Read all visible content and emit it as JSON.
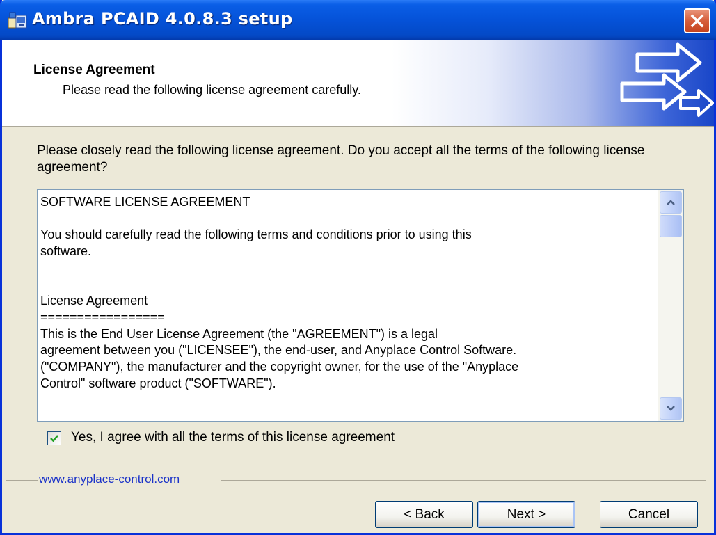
{
  "window": {
    "title": "Ambra PCAID 4.0.8.3 setup",
    "icon": "setup-package-icon"
  },
  "header": {
    "title": "License Agreement",
    "subtitle": "Please read the following license agreement carefully.",
    "graphic": "arrows-graphic"
  },
  "body": {
    "prompt": "Please closely read the following license agreement. Do you accept all the terms of the following license agreement?",
    "license_text": "SOFTWARE LICENSE AGREEMENT\n\nYou should carefully read the following terms and conditions prior to using this\nsoftware.\n\n\nLicense Agreement\n=================\nThis is the End User License Agreement (the \"AGREEMENT\") is a legal\nagreement between you (\"LICENSEE\"), the end-user, and Anyplace Control Software.\n(\"COMPANY\"), the manufacturer and the copyright owner, for the use of the \"Anyplace\nControl\" software product (\"SOFTWARE\").",
    "agree_label": "Yes, I agree with all the terms of this license agreement",
    "agree_checked": true
  },
  "footer": {
    "website": "www.anyplace-control.com",
    "back_label": "< Back",
    "next_label": "Next >",
    "cancel_label": "Cancel"
  },
  "colors": {
    "titlebar": "#0552d8",
    "dialog_bg": "#ece9d8",
    "link": "#1a32c8"
  }
}
